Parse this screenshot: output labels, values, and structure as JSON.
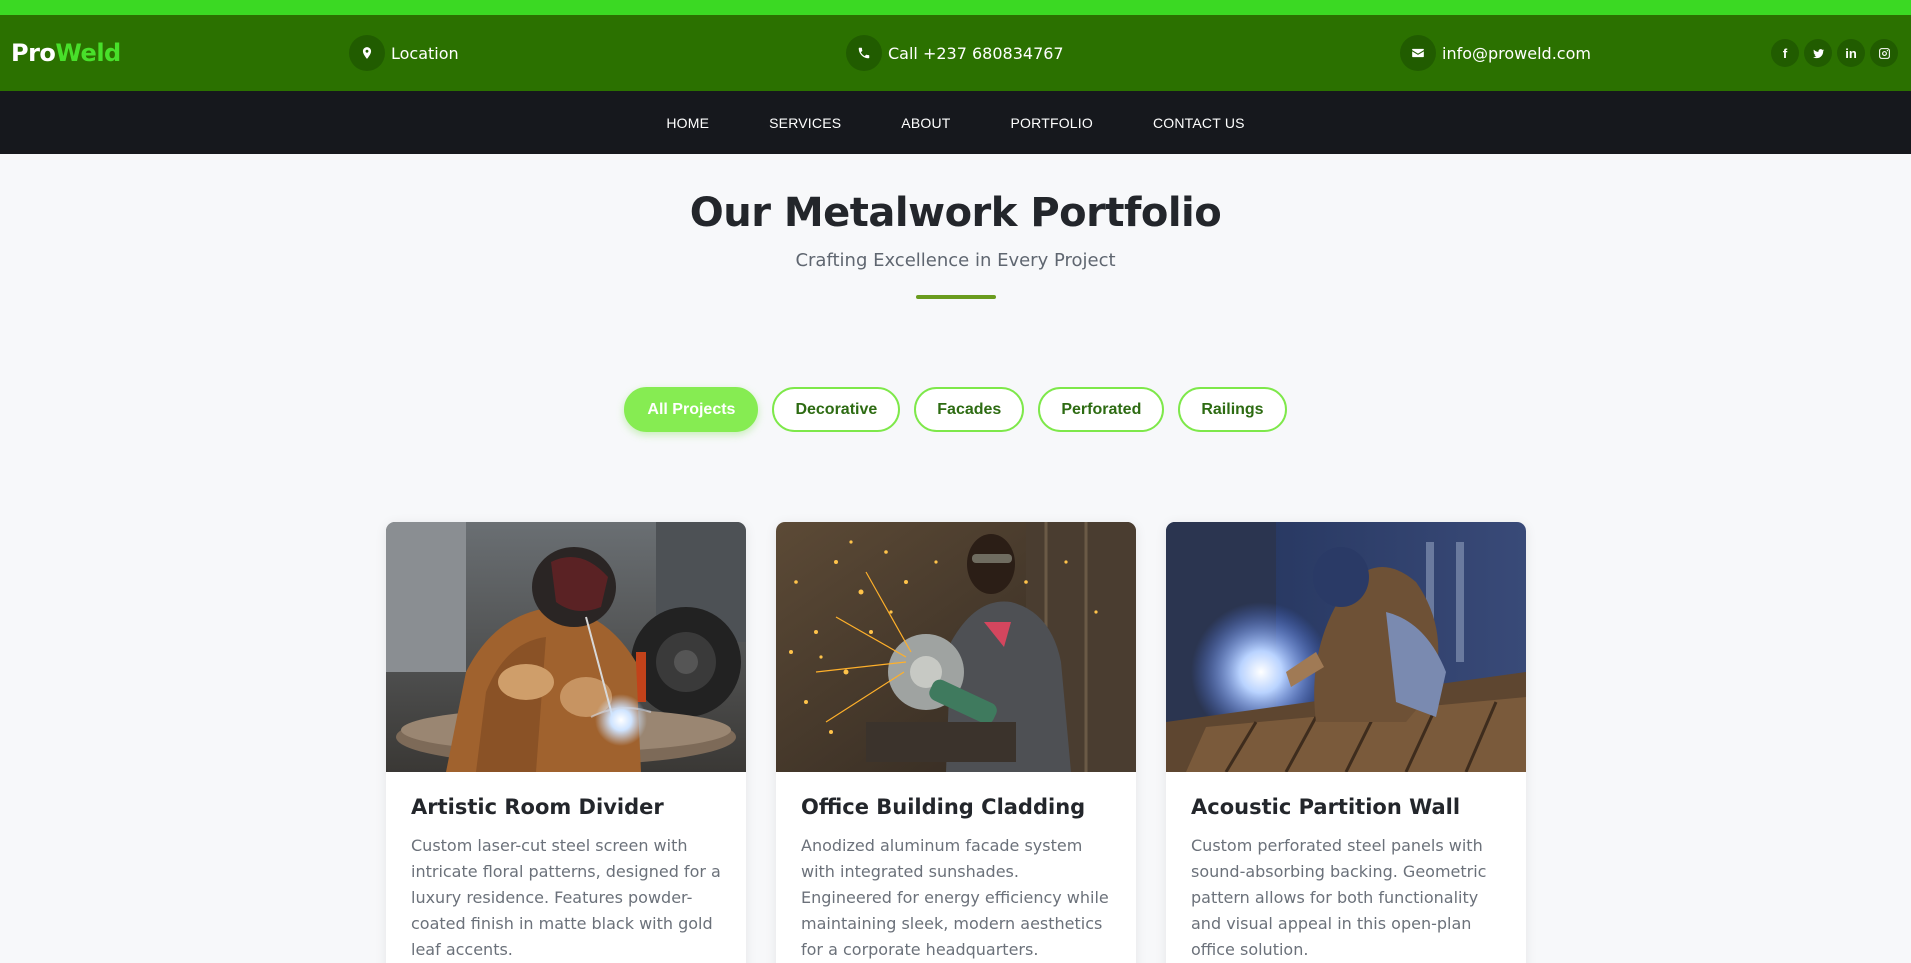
{
  "brand": {
    "part1": "Pro",
    "part2": "Weld"
  },
  "contact": {
    "location": "Location",
    "phone": "Call +237 680834767",
    "email": "info@proweld.com"
  },
  "icons": {
    "location": "map-marker-icon",
    "phone": "phone-icon",
    "email": "envelope-icon",
    "social": [
      "facebook-icon",
      "twitter-icon",
      "linkedin-icon",
      "instagram-icon"
    ]
  },
  "social_glyphs": {
    "facebook": "f",
    "linkedin": "in"
  },
  "nav": {
    "home": "HOME",
    "services": "SERVICES",
    "about": "ABOUT",
    "portfolio": "PORTFOLIO",
    "contact": "CONTACT US"
  },
  "header": {
    "title": "Our Metalwork Portfolio",
    "subtitle": "Crafting Excellence in Every Project"
  },
  "filters": {
    "all": "All Projects",
    "decorative": "Decorative",
    "facades": "Facades",
    "perforated": "Perforated",
    "railings": "Railings",
    "active": "All Projects"
  },
  "projects": [
    {
      "title": "Artistic Room Divider",
      "description": "Custom laser-cut steel screen with intricate floral patterns, designed for a luxury residence. Features powder-coated finish in matte black with gold leaf accents.",
      "image": "welder with mask and gloves welding a round steel plate"
    },
    {
      "title": "Office Building Cladding",
      "description": "Anodized aluminum facade system with integrated sunshades. Engineered for energy efficiency while maintaining sleek, modern aesthetics for a corporate headquarters.",
      "image": "worker using angle grinder with sparks flying"
    },
    {
      "title": "Acoustic Partition Wall",
      "description": "Custom perforated steel panels with sound-absorbing backing. Geometric pattern allows for both functionality and visual appeal in this open-plan office solution.",
      "image": "welder crouched over steel beams with bright blue arc light"
    }
  ],
  "colors": {
    "top_strip": "#3bd923",
    "info_bar": "#2b7100",
    "navbar": "#16181d",
    "accent": "#86ec52",
    "underline": "#6a9c1e"
  }
}
